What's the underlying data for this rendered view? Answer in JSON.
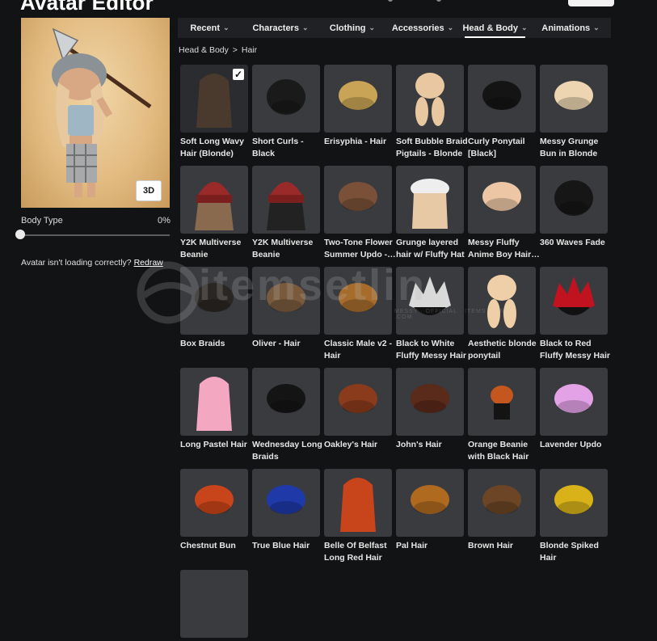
{
  "header": {
    "title": "Avatar Editor"
  },
  "preview": {
    "view_mode_button": "3D"
  },
  "body_type": {
    "label": "Body Type",
    "value": "0%",
    "slider_value": 0
  },
  "redraw": {
    "prompt": "Avatar isn't loading correctly?",
    "link": "Redraw"
  },
  "tabs": [
    {
      "label": "Recent",
      "active": false
    },
    {
      "label": "Characters",
      "active": false
    },
    {
      "label": "Clothing",
      "active": false
    },
    {
      "label": "Accessories",
      "active": false
    },
    {
      "label": "Head & Body",
      "active": true
    },
    {
      "label": "Animations",
      "active": false
    }
  ],
  "breadcrumb": {
    "root": "Head & Body",
    "separator": ">",
    "current": "Hair"
  },
  "watermark": {
    "text": "itemsetlin",
    "sub": "MESSY · OFFICIAL · ITEMS · FIND · .COM"
  },
  "items": [
    {
      "name": "Soft Long Wavy Hair (Blonde)",
      "selected": true,
      "color": "#4a3a2e",
      "shape": "long"
    },
    {
      "name": "Short Curls - Black",
      "selected": false,
      "color": "#1a1a1a",
      "shape": "curls"
    },
    {
      "name": "Erisyphia - Hair",
      "selected": false,
      "color": "#caa456",
      "shape": "updo"
    },
    {
      "name": "Soft Bubble Braid Pigtails - Blonde",
      "selected": false,
      "color": "#e9c7a0",
      "shape": "pigtails"
    },
    {
      "name": "Curly Ponytail [Black]",
      "selected": false,
      "color": "#141414",
      "shape": "ponytail"
    },
    {
      "name": "Messy Grunge Bun in Blonde",
      "selected": false,
      "color": "#ecd5b0",
      "shape": "bun"
    },
    {
      "name": "Y2K Multiverse Beanie",
      "selected": false,
      "color": "#9a2a2a",
      "shape": "beanie"
    },
    {
      "name": "Y2K Multiverse Beanie",
      "selected": false,
      "color": "#9a2a2a",
      "shape": "beanie2"
    },
    {
      "name": "Two-Tone Flower Summer Updo - Brown",
      "selected": false,
      "color": "#7a5138",
      "shape": "twotone"
    },
    {
      "name": "Grunge layered hair w/ Fluffy Hat",
      "selected": false,
      "color": "#e8c9a6",
      "shape": "hat"
    },
    {
      "name": "Messy Fluffy Anime Boy Hair - Blonde",
      "selected": false,
      "color": "#edc7a5",
      "shape": "fluffy"
    },
    {
      "name": "360 Waves Fade",
      "selected": false,
      "color": "#161616",
      "shape": "waves"
    },
    {
      "name": "Box Braids",
      "selected": false,
      "color": "#2a2623",
      "shape": "braids"
    },
    {
      "name": "Oliver - Hair",
      "selected": false,
      "color": "#7a5a3c",
      "shape": "short"
    },
    {
      "name": "Classic Male v2 - Hair",
      "selected": false,
      "color": "#a66c2c",
      "shape": "classic"
    },
    {
      "name": "Black to White Fluffy Messy Hair",
      "selected": false,
      "color": "#d9d9d9",
      "shape": "spiky"
    },
    {
      "name": "Aesthetic blonde ponytail",
      "selected": false,
      "color": "#efcfa8",
      "shape": "ponytail2"
    },
    {
      "name": "Black to Red Fluffy Messy Hair",
      "selected": false,
      "color": "#c1121f",
      "shape": "redblack"
    },
    {
      "name": "Long Pastel Hair",
      "selected": false,
      "color": "#f4a7c0",
      "shape": "pastel"
    },
    {
      "name": "Wednesday Long Braids",
      "selected": false,
      "color": "#141414",
      "shape": "wednesday"
    },
    {
      "name": "Oakley's Hair",
      "selected": false,
      "color": "#8a3b1c",
      "shape": "oakley"
    },
    {
      "name": "John's Hair",
      "selected": false,
      "color": "#5a2a1a",
      "shape": "john"
    },
    {
      "name": "Orange Beanie with Black Hair",
      "selected": false,
      "color": "#c4561e",
      "shape": "orange"
    },
    {
      "name": "Lavender Updo",
      "selected": false,
      "color": "#e4a2e6",
      "shape": "lavender"
    },
    {
      "name": "Chestnut Bun",
      "selected": false,
      "color": "#c8441a",
      "shape": "chestnut"
    },
    {
      "name": "True Blue Hair",
      "selected": false,
      "color": "#1f3aa8",
      "shape": "blue"
    },
    {
      "name": "Belle Of Belfast Long Red Hair",
      "selected": false,
      "color": "#c8441a",
      "shape": "belle"
    },
    {
      "name": "Pal Hair",
      "selected": false,
      "color": "#b06a20",
      "shape": "pal"
    },
    {
      "name": "Brown Hair",
      "selected": false,
      "color": "#6b4526",
      "shape": "brown"
    },
    {
      "name": "Blonde Spiked Hair",
      "selected": false,
      "color": "#d9b21a",
      "shape": "blondespike"
    },
    {
      "name": "",
      "selected": false,
      "color": "#393b3f",
      "shape": "none"
    }
  ]
}
